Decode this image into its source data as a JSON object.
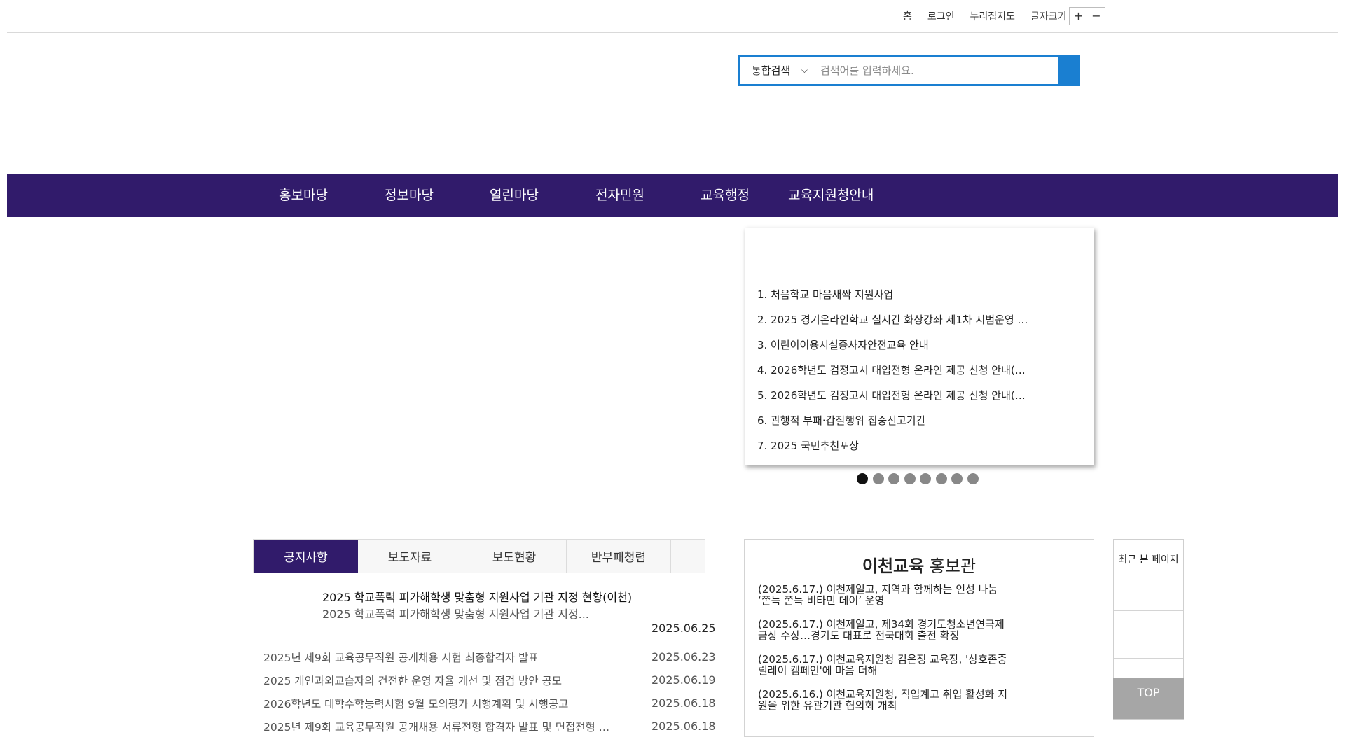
{
  "util": {
    "home": "홈",
    "login": "로그인",
    "sitemap": "누리집지도",
    "font_size": "글자크기",
    "plus": "+",
    "minus": "−"
  },
  "search": {
    "scope": "통합검색",
    "placeholder": "검색어를 입력하세요."
  },
  "gnb": [
    "홍보마당",
    "정보마당",
    "열린마당",
    "전자민원",
    "교육행정",
    "교육지원청안내"
  ],
  "popular": [
    "1. 처음학교 마음새싹 지원사업",
    "2. 2025 경기온라인학교 실시간 화상강좌 제1차 시범운영 …",
    "3. 어린이이용시설종사자안전교육 안내",
    "4. 2026학년도 검정고시 대입전형 온라인 제공 신청 안내(…",
    "5. 2026학년도 검정고시 대입전형 온라인 제공 신청 안내(…",
    "6. 관행적 부패·갑질행위 집중신고기간",
    "7. 2025 국민추천포상"
  ],
  "slider": {
    "count": 8,
    "active": 1
  },
  "tabs": [
    "공지사항",
    "보도자료",
    "보도현황",
    "반부패청렴"
  ],
  "featured": {
    "title": "2025 학교폭력 피가해학생 맞춤형 지원사업 기관 지정 현황(이천)",
    "summary": "2025 학교폭력 피가해학생 맞춤형 지원사업 기관 지정...",
    "date": "2025.06.25"
  },
  "notices": [
    {
      "title": "2025년 제9회 교육공무직원 공개채용 시험 최종합격자 발표",
      "date": "2025.06.23"
    },
    {
      "title": "2025 개인과외교습자의 건전한 운영 자율 개선 및 점검 방안 공모",
      "date": "2025.06.19"
    },
    {
      "title": "2026학년도 대학수학능력시험 9월 모의평가 시행계획 및 시행공고",
      "date": "2025.06.18"
    },
    {
      "title": "2025년 제9회 교육공무직원 공개채용 서류전형 합격자 발표 및 면접전형 …",
      "date": "2025.06.18"
    }
  ],
  "promo": {
    "title_bold": "이천교육",
    "title_rest": " 홍보관",
    "items": [
      "(2025.6.17.) 이천제일고, 지역과 함께하는 인성 나눔 ‘쫀득 쫀득 비타민 데이’ 운영",
      "(2025.6.17.) 이천제일고, 제34회 경기도청소년연극제 금상 수상…경기도 대표로 전국대회 출전 확정",
      "(2025.6.17.) 이천교육지원청 김은정 교육장, '상호존중 릴레이 캠페인'에 마음 더해",
      "(2025.6.16.) 이천교육지원청, 직업계고 취업 활성화 지원을 위한 유관기관 협의회 개최"
    ]
  },
  "recent": {
    "title": "최근 본 페이지"
  },
  "top_button": "TOP",
  "colors": {
    "brand": "#311b6b",
    "search_accent": "#1a7fd1"
  }
}
